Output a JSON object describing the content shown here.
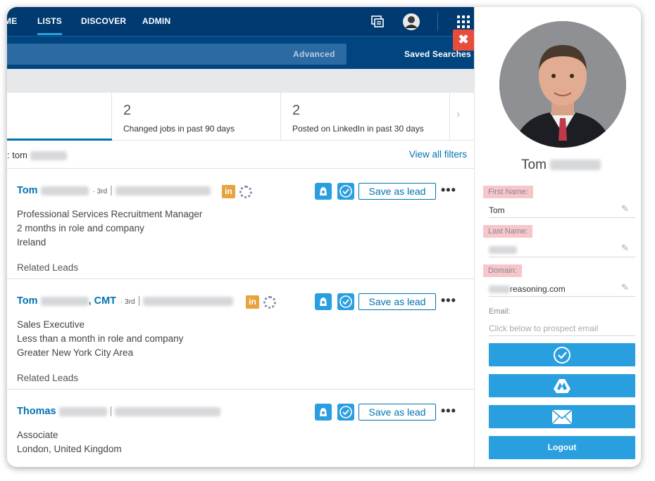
{
  "nav": {
    "items": [
      {
        "label": "ME",
        "active": false
      },
      {
        "label": "LISTS",
        "active": true
      },
      {
        "label": "DISCOVER",
        "active": false
      },
      {
        "label": "ADMIN",
        "active": false
      }
    ],
    "icons": [
      "messages-icon",
      "profile-avatar-icon",
      "apps-grid-icon"
    ]
  },
  "search": {
    "advanced_label": "Advanced",
    "saved_searches_label": "Saved Searches",
    "close_label": "✖"
  },
  "stats": [
    {
      "count": "",
      "label": ""
    },
    {
      "count": "2",
      "label": "Changed jobs in past 90 days"
    },
    {
      "count": "2",
      "label": "Posted on LinkedIn in past 30 days"
    }
  ],
  "filter": {
    "text": ": tom",
    "view_all_label": "View all filters"
  },
  "results": [
    {
      "first_name": "Tom",
      "suffix": "",
      "degree": "3rd",
      "title": "Professional Services Recruitment Manager",
      "tenure": "2 months in role and company",
      "location": "Ireland",
      "related": "Related Leads",
      "save_label": "Save as lead",
      "more_label": "•••",
      "linkedin_badge": "in"
    },
    {
      "first_name": "Tom",
      "suffix": ", CMT",
      "degree": "3rd",
      "title": "Sales Executive",
      "tenure": "Less than a month in role and company",
      "location": "Greater New York City Area",
      "related": "Related Leads",
      "save_label": "Save as lead",
      "more_label": "•••",
      "linkedin_badge": "in"
    },
    {
      "first_name": "Thomas",
      "suffix": "",
      "degree": "",
      "title": "Associate",
      "tenure": "London, United Kingdom",
      "location": "",
      "related": "",
      "save_label": "Save as lead",
      "more_label": "•••",
      "linkedin_badge": ""
    }
  ],
  "sidebar": {
    "name": "Tom",
    "first_name_label": "First Name:",
    "first_name_value": "Tom",
    "last_name_label": "Last Name:",
    "last_name_value": "",
    "domain_label": "Domain:",
    "domain_value": "reasoning.com",
    "email_label": "Email:",
    "email_placeholder": "Click below to prospect email",
    "buttons": [
      "verify-check-icon",
      "google-drive-icon",
      "envelope-icon"
    ],
    "logout_label": "Logout"
  },
  "colors": {
    "nav_bg": "#003a70",
    "search_bg": "#00457f",
    "link_blue": "#0073b1",
    "action_blue": "#2a9fe0",
    "close_red": "#e74c3c",
    "linkedin_badge": "#e7a33e",
    "label_pink": "#f6c6cb"
  }
}
